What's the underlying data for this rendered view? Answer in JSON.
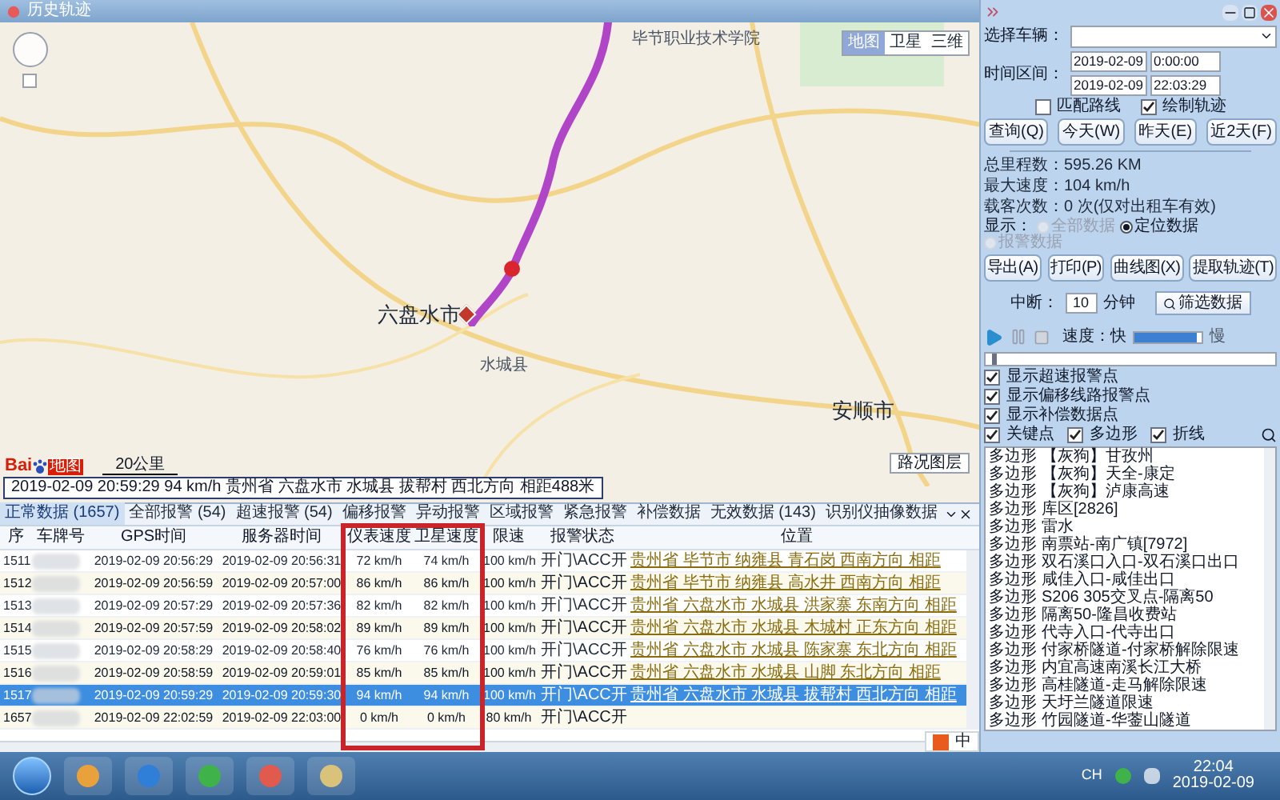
{
  "window": {
    "title": "历史轨迹"
  },
  "map": {
    "labels": [
      "六盘水市",
      "安顺市",
      "水城县",
      "毕节职业技术学院"
    ],
    "map_types": [
      {
        "label": "地图",
        "selected": true
      },
      {
        "label": "卫星",
        "selected": false
      },
      {
        "label": "三维",
        "selected": false
      }
    ],
    "logo": {
      "left": "Bai",
      "right": "地图"
    },
    "scale": "20公里",
    "traffic_button": "路况图层",
    "info": "2019-02-09 20:59:29   94 km/h   贵州省 六盘水市 水城县 拔帮村 西北方向 相距488米"
  },
  "tabs": [
    {
      "label": "正常数据 (1657)",
      "selected": true
    },
    {
      "label": "全部报警 (54)",
      "selected": false
    },
    {
      "label": "超速报警 (54)",
      "selected": false
    },
    {
      "label": "偏移报警",
      "selected": false
    },
    {
      "label": "异动报警",
      "selected": false
    },
    {
      "label": "区域报警",
      "selected": false
    },
    {
      "label": "紧急报警",
      "selected": false
    },
    {
      "label": "补偿数据",
      "selected": false
    },
    {
      "label": "无效数据 (143)",
      "selected": false
    },
    {
      "label": "识别仪抽像数据",
      "selected": false
    }
  ],
  "table": {
    "columns": [
      "序",
      "车牌号",
      "GPS时间",
      "服务器时间",
      "仪表速度",
      "卫星速度",
      "限速",
      "报警状态",
      "位置"
    ],
    "rows": [
      {
        "seq": "1511",
        "gps": "2019-02-09 20:56:29",
        "server": "2019-02-09 20:56:31",
        "meter": "72 km/h",
        "sat": "74 km/h",
        "limit": "100 km/h",
        "status": "开门\\ACC开",
        "position": "贵州省 毕节市 纳雍县 青石岗 西南方向 相距",
        "selected": false
      },
      {
        "seq": "1512",
        "gps": "2019-02-09 20:56:59",
        "server": "2019-02-09 20:57:00",
        "meter": "86 km/h",
        "sat": "86 km/h",
        "limit": "100 km/h",
        "status": "开门\\ACC开",
        "position": "贵州省 毕节市 纳雍县 高水井 西南方向 相距",
        "selected": false
      },
      {
        "seq": "1513",
        "gps": "2019-02-09 20:57:29",
        "server": "2019-02-09 20:57:36",
        "meter": "82 km/h",
        "sat": "82 km/h",
        "limit": "100 km/h",
        "status": "开门\\ACC开",
        "position": "贵州省 六盘水市 水城县 洪家寨 东南方向 相距",
        "selected": false
      },
      {
        "seq": "1514",
        "gps": "2019-02-09 20:57:59",
        "server": "2019-02-09 20:58:02",
        "meter": "89 km/h",
        "sat": "89 km/h",
        "limit": "100 km/h",
        "status": "开门\\ACC开",
        "position": "贵州省 六盘水市 水城县 木城村 正东方向 相距",
        "selected": false
      },
      {
        "seq": "1515",
        "gps": "2019-02-09 20:58:29",
        "server": "2019-02-09 20:58:40",
        "meter": "76 km/h",
        "sat": "76 km/h",
        "limit": "100 km/h",
        "status": "开门\\ACC开",
        "position": "贵州省 六盘水市 水城县 陈家寨 东北方向 相距",
        "selected": false
      },
      {
        "seq": "1516",
        "gps": "2019-02-09 20:58:59",
        "server": "2019-02-09 20:59:01",
        "meter": "85 km/h",
        "sat": "85 km/h",
        "limit": "100 km/h",
        "status": "开门\\ACC开",
        "position": "贵州省 六盘水市 水城县 山脚 东北方向 相距",
        "selected": false
      },
      {
        "seq": "1517",
        "gps": "2019-02-09 20:59:29",
        "server": "2019-02-09 20:59:30",
        "meter": "94 km/h",
        "sat": "94 km/h",
        "limit": "100 km/h",
        "status": "开门\\ACC开",
        "position": "贵州省 六盘水市 水城县 拔帮村 西北方向 相距",
        "selected": true
      },
      {
        "seq": "1657",
        "gps": "2019-02-09 22:02:59",
        "server": "2019-02-09 22:03:00",
        "meter": "0 km/h",
        "sat": "0 km/h",
        "limit": "80 km/h",
        "status": "开门\\ACC开",
        "selected": false
      }
    ]
  },
  "panel": {
    "vehicle_label": "选择车辆：",
    "time_label": "时间区间：",
    "start": {
      "date": "2019-02-09",
      "time": "0:00:00"
    },
    "end": {
      "date": "2019-02-09",
      "time": "22:03:29"
    },
    "options": [
      {
        "label": "匹配路线",
        "checked": false
      },
      {
        "label": "绘制轨迹",
        "checked": true
      }
    ],
    "query_buttons": [
      "查询(Q)",
      "今天(W)",
      "昨天(E)",
      "近2天(F)"
    ],
    "stats": [
      "总里程数：595.26 KM",
      "最大速度：104 km/h",
      "载客次数：0 次(仅对出租车有效)"
    ],
    "display_label": "显示：",
    "display_options": [
      {
        "label": "全部数据",
        "selected": false,
        "disabled": true
      },
      {
        "label": "定位数据",
        "selected": true,
        "disabled": false
      },
      {
        "label": "报警数据",
        "selected": false,
        "disabled": true
      }
    ],
    "action_buttons": [
      "导出(A)",
      "打印(P)",
      "曲线图(X)",
      "提取轨迹(T)"
    ],
    "interrupt": {
      "label": "中断：",
      "value": "10",
      "unit": "分钟",
      "button": "筛选数据"
    },
    "speed": {
      "label": "速度：快",
      "slow": "慢",
      "level": 0.93
    },
    "progress": {
      "level": 0.02
    },
    "show_options": [
      {
        "label": "显示超速报警点",
        "checked": true
      },
      {
        "label": "显示偏移线路报警点",
        "checked": true
      },
      {
        "label": "显示补偿数据点",
        "checked": true
      }
    ],
    "filters": [
      {
        "label": "关键点",
        "checked": true
      },
      {
        "label": "多边形",
        "checked": true
      },
      {
        "label": "折线",
        "checked": true
      }
    ],
    "areas": [
      {
        "kind": "多边形",
        "name": "【灰狗】甘孜州"
      },
      {
        "kind": "多边形",
        "name": "【灰狗】天全-康定"
      },
      {
        "kind": "多边形",
        "name": "【灰狗】泸康高速"
      },
      {
        "kind": "多边形",
        "name": "库区[2826]"
      },
      {
        "kind": "多边形",
        "name": "雷水"
      },
      {
        "kind": "多边形",
        "name": "南票站-南广镇[7972]"
      },
      {
        "kind": "多边形",
        "name": "双石溪口入口-双石溪口出口"
      },
      {
        "kind": "多边形",
        "name": "咸佳入口-咸佳出口"
      },
      {
        "kind": "多边形",
        "name": "S206 305交叉点-隔离50"
      },
      {
        "kind": "多边形",
        "name": "隔离50-隆昌收费站"
      },
      {
        "kind": "多边形",
        "name": "代寺入口-代寺出口"
      },
      {
        "kind": "多边形",
        "name": "付家桥隧道-付家桥解除限速"
      },
      {
        "kind": "多边形",
        "name": "内宜高速南溪长江大桥"
      },
      {
        "kind": "多边形",
        "name": "高桂隧道-走马解除限速"
      },
      {
        "kind": "多边形",
        "name": "天圩兰隧道限速"
      },
      {
        "kind": "多边形",
        "name": "竹园隧道-华蓥山隧道"
      }
    ]
  },
  "ime": {
    "label": "中"
  },
  "taskbar": {
    "tray_lang": "CH",
    "time": "22:04",
    "date": "2019-02-09"
  }
}
